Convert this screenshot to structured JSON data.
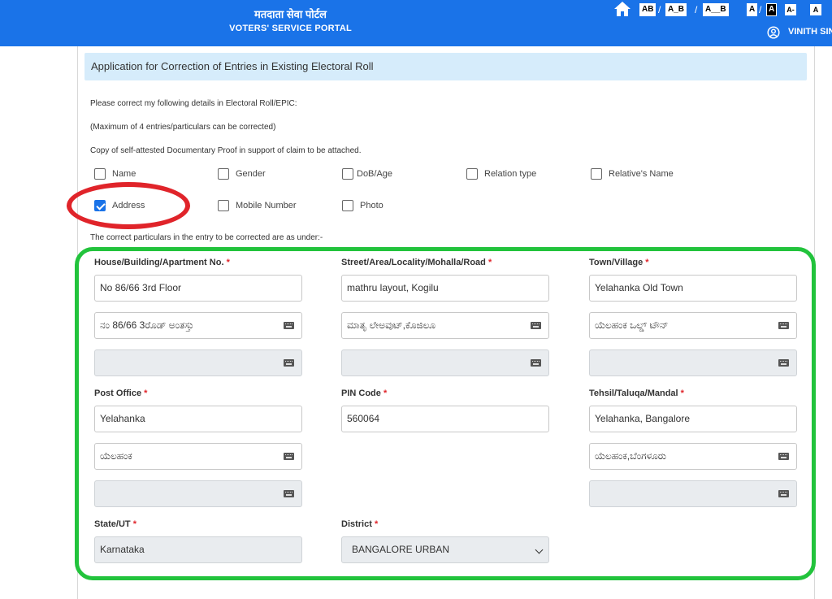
{
  "header": {
    "title_hindi": "मतदाता सेवा पोर्टल",
    "title_english": "VOTERS' SERVICE PORTAL",
    "font_buttons": [
      "AB",
      "/",
      "A_B",
      "/",
      "A__B",
      "A",
      "/",
      "A",
      "A-",
      "A"
    ],
    "user_name": "VINITH SIN",
    "icons": [
      "home-icon",
      "user-icon"
    ]
  },
  "form": {
    "heading": "Application for Correction of Entries in Existing Electoral Roll",
    "note1": "Please correct my following details in Electoral Roll/EPIC:",
    "note2": "(Maximum of 4 entries/particulars can be corrected)",
    "note3": "Copy of self-attested Documentary Proof in support of claim to be attached.",
    "note4": "The correct particulars in the entry to be corrected are as under:-",
    "checkboxes": [
      {
        "label": "Name",
        "checked": false
      },
      {
        "label": "Gender",
        "checked": false
      },
      {
        "label": "DoB/Age",
        "checked": false
      },
      {
        "label": "Relation type",
        "checked": false
      },
      {
        "label": "Relative's Name",
        "checked": false
      },
      {
        "label": "Address",
        "checked": true
      },
      {
        "label": "Mobile Number",
        "checked": false
      },
      {
        "label": "Photo",
        "checked": false
      }
    ],
    "required_mark": "*",
    "fields": {
      "house": {
        "label": "House/Building/Apartment No.",
        "value": "No 86/66 3rd Floor",
        "kannada": "ನಂ 86/66 3ರೊಡ್ ಅಂತಸ್ತು",
        "third": ""
      },
      "street": {
        "label": "Street/Area/Locality/Mohalla/Road",
        "value": "mathru layout, Kogilu",
        "kannada": "ಮಾತೃ ಲೇಅವುಟ್,ಕೊಜಿಲೂ",
        "third": ""
      },
      "town": {
        "label": "Town/Village",
        "value": "Yelahanka Old Town",
        "kannada": "ಯೆಲಹಂಕ ಒಲ್ಡ್ ಟೌನ್",
        "third": ""
      },
      "post_office": {
        "label": "Post Office",
        "value": "Yelahanka",
        "kannada": "ಯೆಲಹಂಕ",
        "third": ""
      },
      "pin": {
        "label": "PIN Code",
        "value": "560064"
      },
      "tehsil": {
        "label": "Tehsil/Taluqa/Mandal",
        "value": "Yelahanka, Bangalore",
        "kannada": "ಯೆಲಹಂಕ,ಬೆಂಗಳೂರು",
        "third": ""
      },
      "state": {
        "label": "State/UT",
        "value": "Karnataka"
      },
      "district": {
        "label": "District",
        "value": "BANGALORE URBAN"
      }
    }
  },
  "annotations": {
    "red_oval_color": "#e0242a",
    "green_box_color": "#22c33c"
  }
}
